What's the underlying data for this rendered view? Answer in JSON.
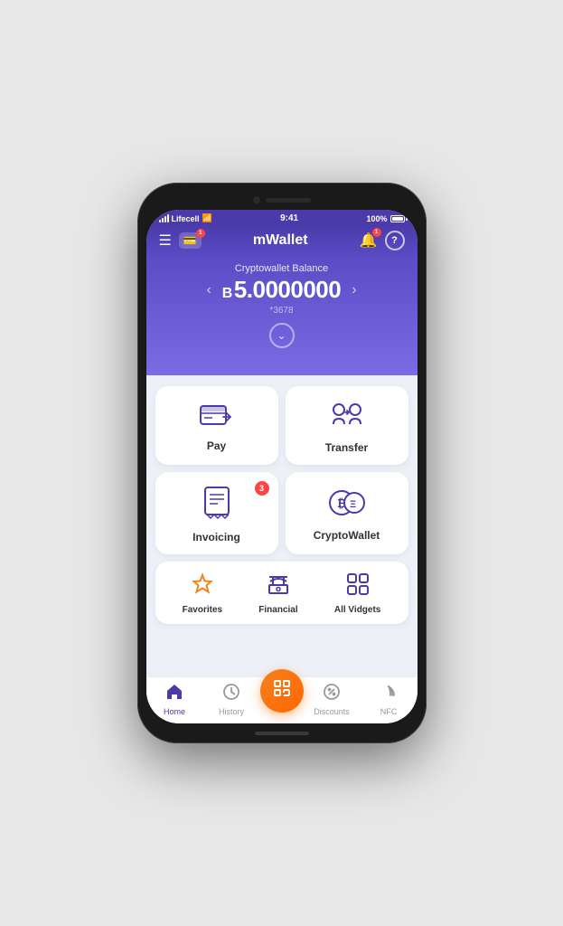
{
  "status_bar": {
    "carrier": "Lifecell",
    "time": "9:41",
    "battery": "100%"
  },
  "header": {
    "title": "mWallet",
    "help_label": "?"
  },
  "balance": {
    "label": "Cryptowallet Balance",
    "currency_symbol": "B",
    "amount": "5.0000000",
    "account_number": "*3678"
  },
  "cards": [
    {
      "id": "pay",
      "label": "Pay",
      "badge": null
    },
    {
      "id": "transfer",
      "label": "Transfer",
      "badge": null
    },
    {
      "id": "invoicing",
      "label": "Invoicing",
      "badge": "3"
    },
    {
      "id": "cryptowallet",
      "label": "CryptoWallet",
      "badge": null
    }
  ],
  "bottom_widgets": [
    {
      "id": "favorites",
      "label": "Favorites",
      "color": "orange"
    },
    {
      "id": "financial",
      "label": "Financial",
      "color": "blue"
    },
    {
      "id": "all_vidgets",
      "label": "All Vidgets",
      "color": "blue"
    }
  ],
  "tabs": [
    {
      "id": "home",
      "label": "Home",
      "active": true
    },
    {
      "id": "history",
      "label": "History",
      "active": false
    },
    {
      "id": "scan",
      "label": "",
      "active": false,
      "center": true
    },
    {
      "id": "discounts",
      "label": "Discounts",
      "active": false
    },
    {
      "id": "nfc",
      "label": "NFC",
      "active": false
    }
  ]
}
